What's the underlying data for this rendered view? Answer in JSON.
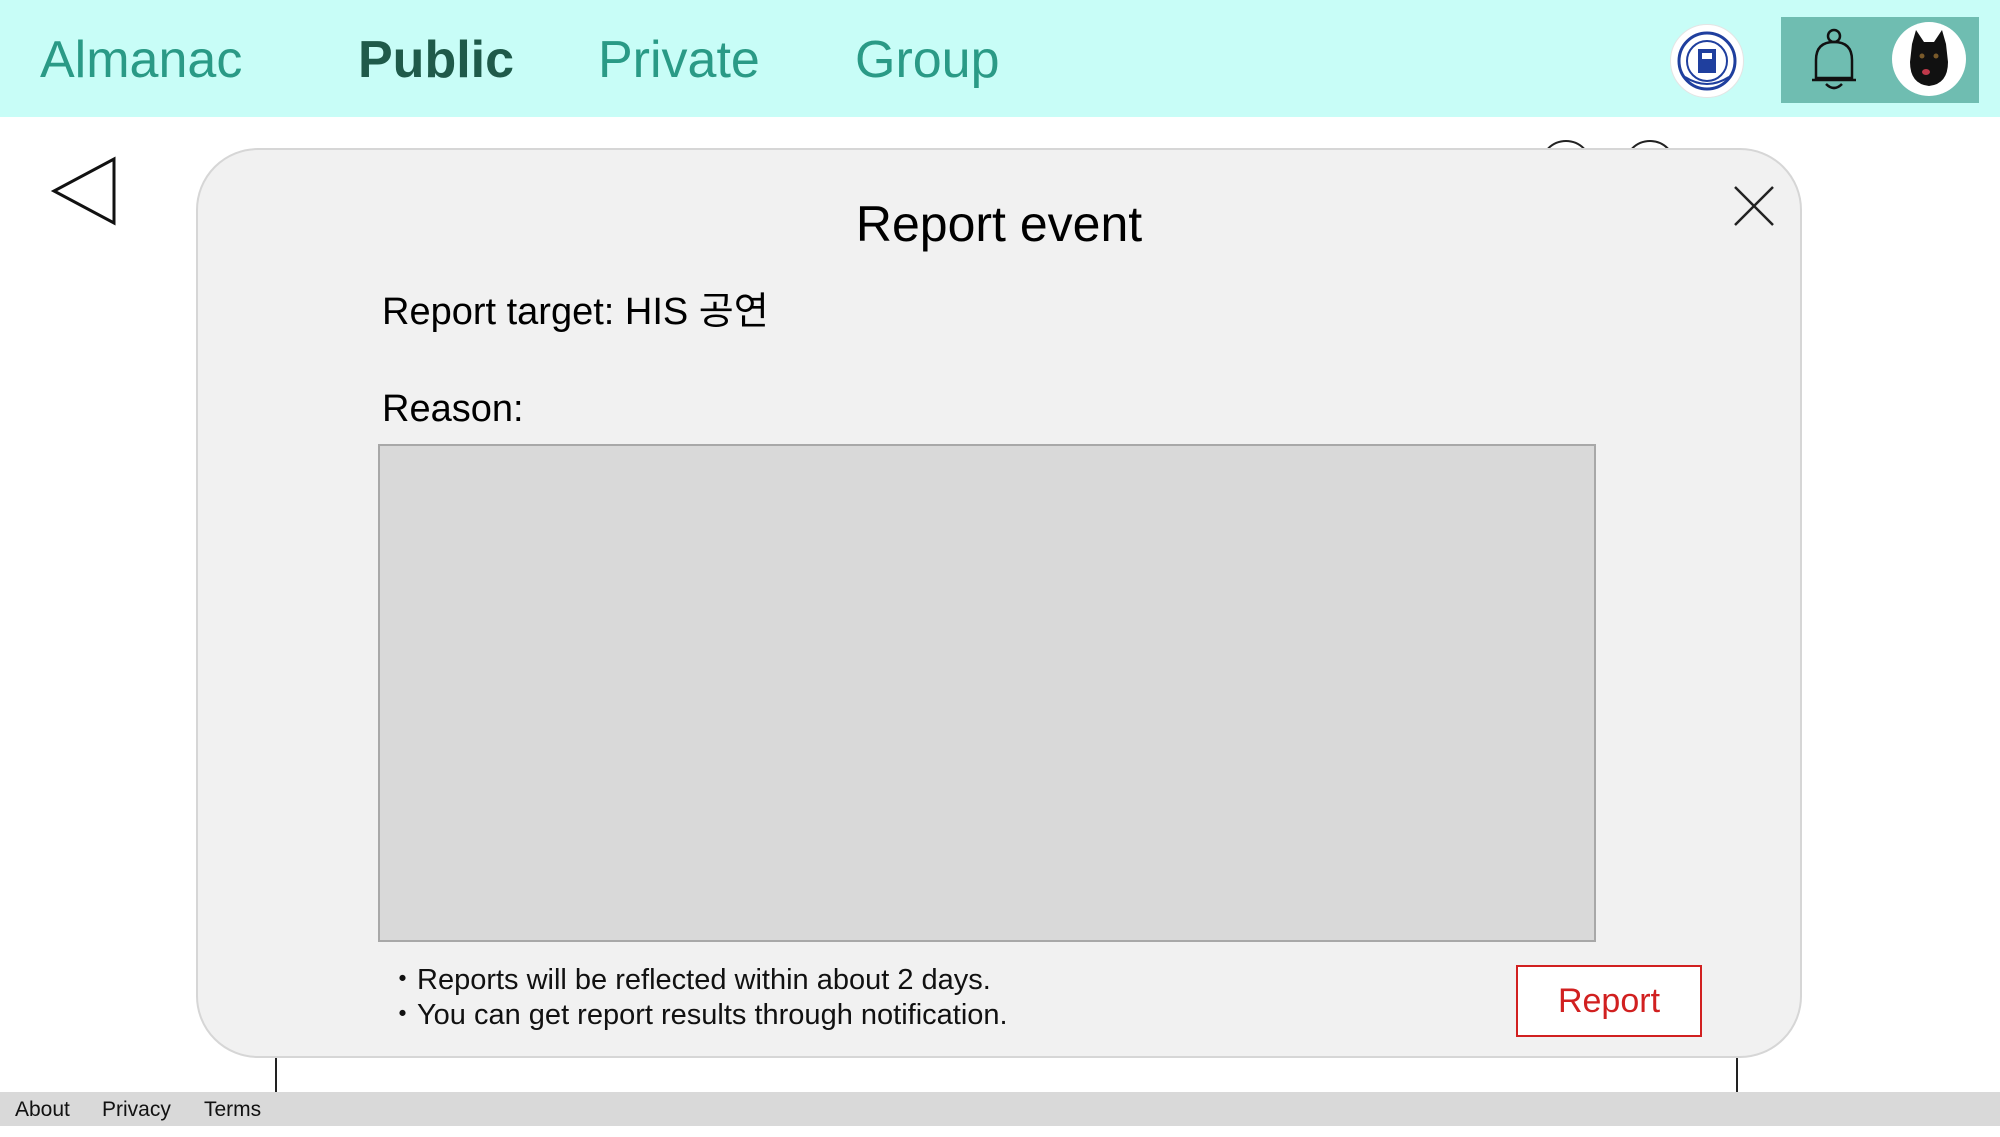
{
  "nav": {
    "brand": "Almanac",
    "tabs": [
      {
        "label": "Public",
        "active": true
      },
      {
        "label": "Private",
        "active": false
      },
      {
        "label": "Group",
        "active": false
      }
    ],
    "icons": {
      "logo": "university-seal-icon",
      "bell": "bell-icon",
      "avatar": "dog-avatar-icon",
      "back": "back-triangle-icon",
      "close": "close-icon"
    }
  },
  "modal": {
    "title": "Report event",
    "target": "Report target: HIS 공연",
    "reason_label": "Reason:",
    "reason_value": "",
    "notes": [
      "・Reports will be reflected within about 2 days.",
      "・You can get report results through notification."
    ],
    "report_button": "Report"
  },
  "footer": {
    "links": [
      "About",
      "Privacy",
      "Terms"
    ]
  },
  "colors": {
    "topbar": "#c8fdf7",
    "nav_text": "#2a9a86",
    "nav_active": "#1f5a4a",
    "right_box": "#6fbdb1",
    "modal_bg": "#f1f1f1",
    "reason_bg": "#d9d9d9",
    "report_red": "#d12020"
  }
}
